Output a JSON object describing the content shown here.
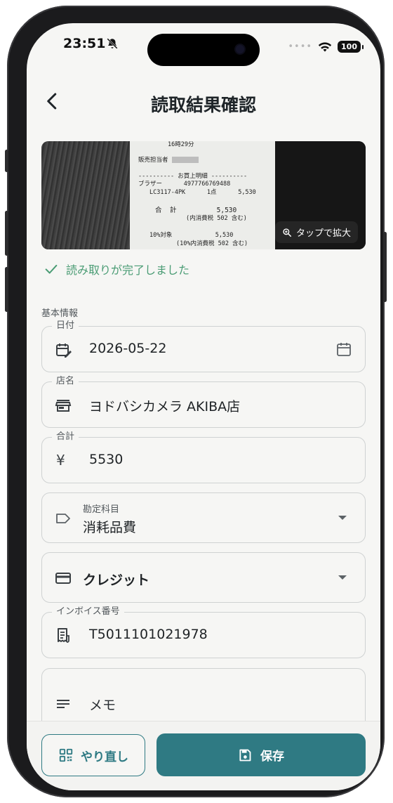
{
  "status_bar": {
    "time": "23:51",
    "battery": "100"
  },
  "header": {
    "title": "読取結果確認"
  },
  "receipt_image": {
    "lines": [
      "16時29分",
      "販売担当者",
      "---------- お買上明細 ----------",
      "ブラザー      4977766769488",
      "LC3117-4PK      1点      5,530",
      "合  計          5,530",
      "(内消費税 502 含む)",
      "10%対象            5,530",
      "(10%内消費税 502 含む)"
    ],
    "zoom_label": "タップで拡大"
  },
  "success_message": "読み取りが完了しました",
  "section_label": "基本情報",
  "fields": {
    "date": {
      "label": "日付",
      "value": "2026-05-22"
    },
    "store": {
      "label": "店名",
      "value": "ヨドバシカメラ AKIBA店"
    },
    "total": {
      "label": "合計",
      "value": "5530",
      "currency_symbol": "¥"
    },
    "account": {
      "label": "勘定科目",
      "value": "消耗品費"
    },
    "payment": {
      "value": "クレジット"
    },
    "invoice": {
      "label": "インボイス番号",
      "value": "T5011101021978"
    },
    "memo": {
      "placeholder": "メモ"
    }
  },
  "actions": {
    "retry_label": "やり直し",
    "save_label": "保存"
  },
  "colors": {
    "accent": "#2f7a83",
    "success": "#4a9c74",
    "background": "#f6f6f4"
  },
  "icons": [
    "bell-slash-icon",
    "wifi-icon",
    "back-arrow-icon",
    "zoom-icon",
    "check-icon",
    "calendar-edit-icon",
    "calendar-icon",
    "store-icon",
    "yen-icon",
    "tag-icon",
    "credit-card-icon",
    "receipt-icon",
    "notes-icon",
    "qr-scan-icon",
    "save-icon"
  ]
}
